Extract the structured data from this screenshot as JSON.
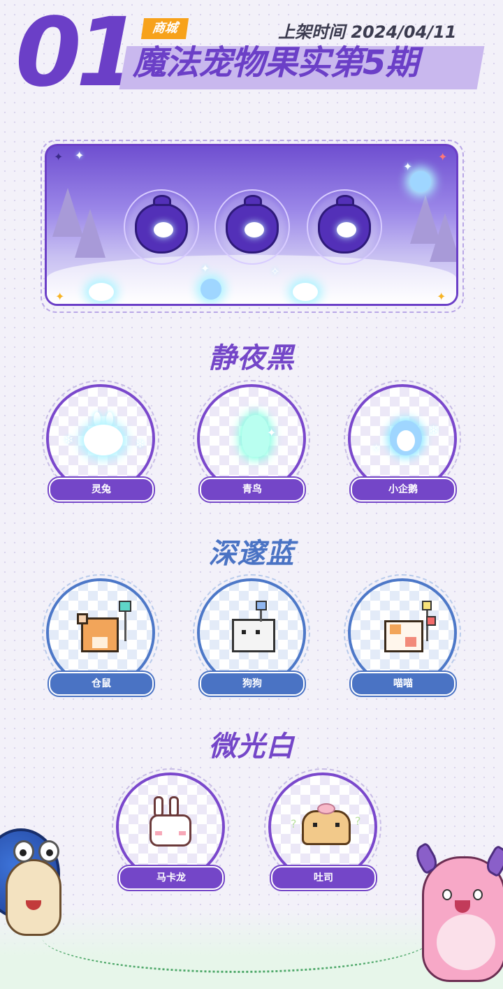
{
  "header": {
    "issue_number": "01",
    "tag": "商城",
    "release_label": "上架时间",
    "release_date": "2024/04/11",
    "title": "魔法宠物果实第5期"
  },
  "colors": {
    "purple": "#6b3fc7",
    "blue": "#4a73c4",
    "tag_orange": "#f7a21b",
    "title_band": "#c9b8ee"
  },
  "sections": [
    {
      "title": "静夜黑",
      "color": "#7446c8",
      "pets": [
        {
          "name": "灵兔",
          "icon": "glowing-rabbit-icon"
        },
        {
          "name": "青鸟",
          "icon": "glowing-bird-icon"
        },
        {
          "name": "小企鹅",
          "icon": "glowing-penguin-icon"
        }
      ]
    },
    {
      "title": "深邃蓝",
      "color": "#4a73c4",
      "pets": [
        {
          "name": "仓鼠",
          "icon": "pixel-hamster-icon"
        },
        {
          "name": "狗狗",
          "icon": "pixel-dog-icon"
        },
        {
          "name": "喵喵",
          "icon": "pixel-cat-icon"
        }
      ]
    },
    {
      "title": "微光白",
      "color": "#7446c8",
      "pets": [
        {
          "name": "马卡龙",
          "icon": "pixel-bunny-icon"
        },
        {
          "name": "吐司",
          "icon": "pixel-toast-icon"
        }
      ]
    }
  ]
}
